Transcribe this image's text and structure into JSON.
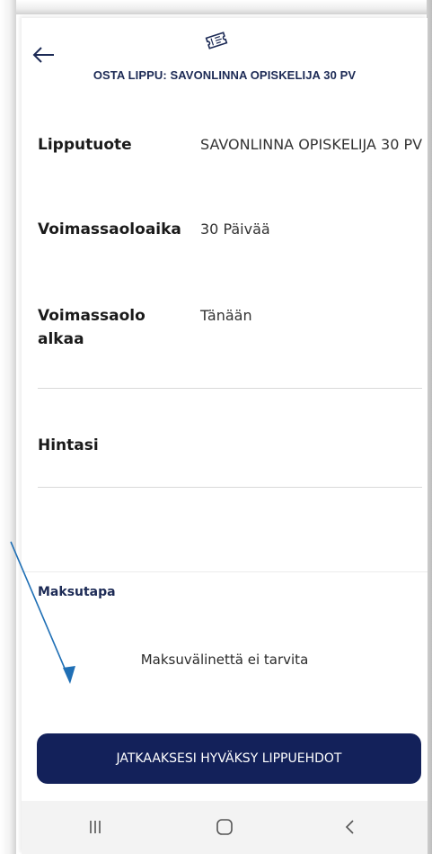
{
  "header": {
    "title": "OSTA LIPPU: SAVONLINNA OPISKELIJA 30 PV",
    "back_icon": "back-arrow-icon",
    "ticket_icon": "ticket-icon"
  },
  "details": {
    "product": {
      "label": "Lipputuote",
      "value": "SAVONLINNA OPISKELIJA 30 PV"
    },
    "validity": {
      "label": "Voimassaoloaika",
      "value": "30 Päivää"
    },
    "start": {
      "label": "Voimassaolo alkaa",
      "value": "Tänään"
    },
    "price": {
      "label": "Hintasi",
      "value": ""
    }
  },
  "payment": {
    "heading": "Maksutapa",
    "message": "Maksuvälinettä ei tarvita"
  },
  "cta": {
    "label": "JATKAAKSESI HYVÄKSY LIPPUEHDOT"
  },
  "navbar": {
    "recents_icon": "recents-icon",
    "home_icon": "home-icon",
    "back_icon": "nav-back-icon"
  },
  "colors": {
    "brand_navy": "#13215a",
    "title_navy": "#1c2a55",
    "annotation_blue": "#1f6fb5"
  }
}
